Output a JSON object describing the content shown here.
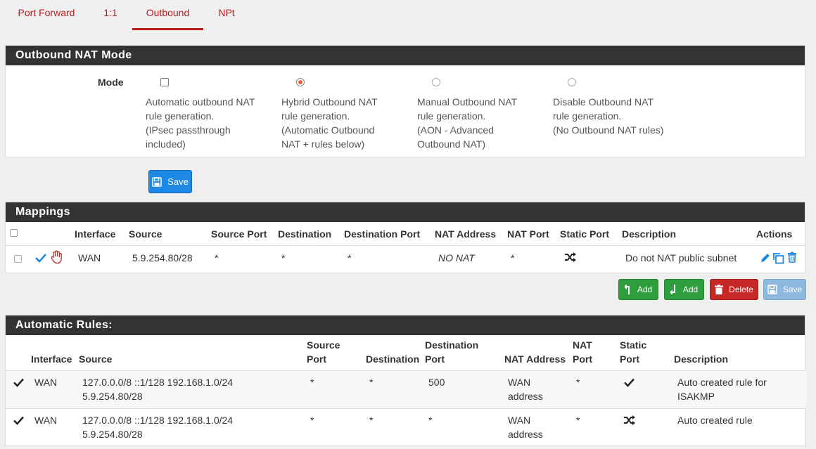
{
  "tabs": [
    {
      "label": "Port Forward"
    },
    {
      "label": "1:1"
    },
    {
      "label": "Outbound"
    },
    {
      "label": "NPt"
    }
  ],
  "outbound_mode": {
    "heading": "Outbound NAT Mode",
    "mode_label": "Mode",
    "options": [
      {
        "label": "Automatic outbound NAT rule generation. (IPsec passthrough included)",
        "lines": [
          "Automatic outbound NAT",
          "rule generation.",
          "(IPsec passthrough",
          "included)"
        ],
        "selected": false
      },
      {
        "label": "Hybrid Outbound NAT rule generation. (Automatic Outbound NAT + rules below)",
        "lines": [
          "Hybrid Outbound NAT",
          "rule generation.",
          "(Automatic Outbound",
          "NAT + rules below)"
        ],
        "selected": true
      },
      {
        "label": "Manual Outbound NAT rule generation. (AON - Advanced Outbound NAT)",
        "lines": [
          "Manual Outbound NAT",
          "rule generation.",
          "(AON - Advanced",
          "Outbound NAT)"
        ],
        "selected": false
      },
      {
        "label": "Disable Outbound NAT rule generation. (No Outbound NAT rules)",
        "lines": [
          "Disable Outbound NAT",
          "rule generation.",
          "(No Outbound NAT rules)"
        ],
        "selected": false
      }
    ],
    "save_label": "Save"
  },
  "mappings": {
    "heading": "Mappings",
    "columns": [
      "Interface",
      "Source",
      "Source Port",
      "Destination",
      "Destination Port",
      "NAT Address",
      "NAT Port",
      "Static Port",
      "Description",
      "Actions"
    ],
    "rows": [
      {
        "interface": "WAN",
        "source": "5.9.254.80/28",
        "source_port": "*",
        "destination": "*",
        "destination_port": "*",
        "nat_address": "NO NAT",
        "nat_port": "*",
        "static_port": "shuffle-icon",
        "description": "Do not NAT public subnet"
      }
    ],
    "buttons": {
      "add_top": "Add",
      "add_bottom": "Add",
      "delete": "Delete",
      "save": "Save"
    }
  },
  "automatic_rules": {
    "heading": "Automatic Rules:",
    "columns": {
      "interface": "Interface",
      "source": "Source",
      "source_port_1": "Source",
      "source_port_2": "Port",
      "destination": "Destination",
      "destination_port_1": "Destination",
      "destination_port_2": "Port",
      "nat_address": "NAT Address",
      "nat_port_1": "NAT",
      "nat_port_2": "Port",
      "static_port_1": "Static",
      "static_port_2": "Port",
      "description": "Description"
    },
    "rows": [
      {
        "interface": "WAN",
        "source_1": "127.0.0.0/8 ::1/128 192.168.1.0/24",
        "source_2": "5.9.254.80/28",
        "source_port": "*",
        "destination": "*",
        "destination_port": "500",
        "nat_address_1": "WAN",
        "nat_address_2": "address",
        "nat_port": "*",
        "static_port": "check-icon",
        "description_1": "Auto created rule for",
        "description_2": "ISAKMP"
      },
      {
        "interface": "WAN",
        "source_1": "127.0.0.0/8 ::1/128 192.168.1.0/24",
        "source_2": "5.9.254.80/28",
        "source_port": "*",
        "destination": "*",
        "destination_port": "*",
        "nat_address_1": "WAN",
        "nat_address_2": "address",
        "nat_port": "*",
        "static_port": "shuffle-icon",
        "description_1": "Auto created rule",
        "description_2": ""
      }
    ]
  },
  "colors": {
    "accent": "#b71c1c",
    "primary": "#1e88e5",
    "success": "#2e9d3e",
    "danger": "#c62828",
    "radio_selected": "#e8662c"
  }
}
